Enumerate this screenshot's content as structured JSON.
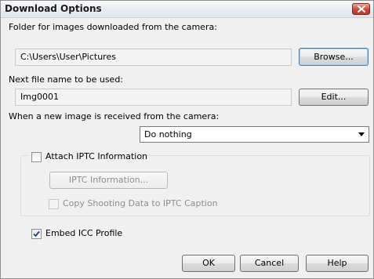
{
  "window": {
    "title": "Download Options",
    "close_icon": "close-icon",
    "accent": "#c9483b"
  },
  "folder": {
    "label": "Folder for images downloaded from the camera:",
    "value": "C:\\Users\\User\\Pictures",
    "browse_label": "Browse..."
  },
  "next_file": {
    "label": "Next file name to be used:",
    "value": "Img0001",
    "edit_label": "Edit..."
  },
  "on_receive": {
    "label": "When a new image is received from the camera:",
    "selected": "Do nothing"
  },
  "iptc": {
    "attach_label": "Attach IPTC Information",
    "attach_checked": false,
    "info_button_label": "IPTC Information...",
    "copy_label": "Copy Shooting Data to IPTC Caption",
    "copy_checked": false
  },
  "icc": {
    "label": "Embed ICC Profile",
    "checked": true
  },
  "buttons": {
    "ok": "OK",
    "cancel": "Cancel",
    "help": "Help"
  }
}
